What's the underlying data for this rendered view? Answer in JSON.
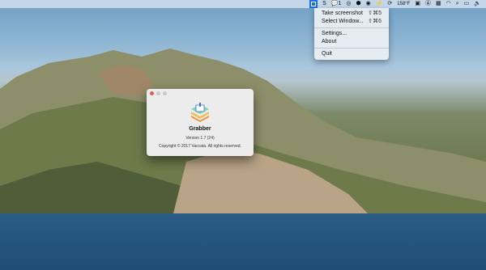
{
  "menubar": {
    "items": [
      {
        "icon": "grabber-icon"
      },
      {
        "text": "S"
      },
      {
        "text": "1",
        "icon": "chat-icon"
      },
      {
        "icon": "globe-icon"
      },
      {
        "icon": "cube-icon"
      },
      {
        "icon": "target-icon"
      },
      {
        "icon": "bolt-icon"
      },
      {
        "icon": "sync-icon"
      },
      {
        "text": "158°F"
      },
      {
        "icon": "trash-icon"
      },
      {
        "icon": "a-icon"
      },
      {
        "icon": "grid-icon"
      },
      {
        "icon": "wifi-icon"
      },
      {
        "icon": "search-icon"
      },
      {
        "icon": "screen-icon"
      },
      {
        "icon": "speaker-icon"
      }
    ],
    "temp": "158°F"
  },
  "menu": {
    "take_screenshot": "Take screenshot",
    "take_screenshot_shortcut": "⇧⌘5",
    "select_window": "Select Window...",
    "select_window_shortcut": "⇧⌘6",
    "settings": "Settings...",
    "about": "About",
    "quit": "Quit"
  },
  "about": {
    "app_name": "Grabber",
    "version": "Version 1.7 (24)",
    "copyright": "Copyright © 2017 Vaccata. All rights reserved."
  },
  "colors": {
    "accent": "#1b6fe0",
    "close": "#ee5a52"
  }
}
